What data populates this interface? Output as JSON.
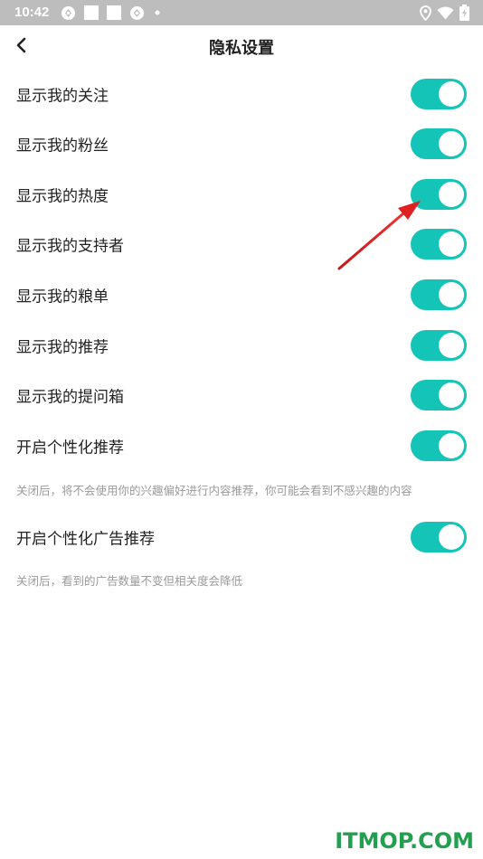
{
  "status_bar": {
    "time": "10:42",
    "left_icons": [
      "sync-icon",
      "square-notification-icon",
      "square-notification-icon",
      "sync-icon",
      "dot-icon"
    ],
    "right_icons": [
      "location-icon",
      "wifi-icon",
      "battery-charging-icon"
    ]
  },
  "header": {
    "title": "隐私设置",
    "back_icon": "chevron-left-icon"
  },
  "settings": [
    {
      "label": "显示我的关注",
      "enabled": true
    },
    {
      "label": "显示我的粉丝",
      "enabled": true
    },
    {
      "label": "显示我的热度",
      "enabled": true
    },
    {
      "label": "显示我的支持者",
      "enabled": true
    },
    {
      "label": "显示我的粮单",
      "enabled": true
    },
    {
      "label": "显示我的推荐",
      "enabled": true
    },
    {
      "label": "显示我的提问箱",
      "enabled": true
    },
    {
      "label": "开启个性化推荐",
      "enabled": true,
      "hint": "关闭后，将不会使用你的兴趣偏好进行内容推荐，你可能会看到不感兴趣的内容"
    },
    {
      "label": "开启个性化广告推荐",
      "enabled": true,
      "hint": "关闭后，看到的广告数量不变但相关度会降低"
    }
  ],
  "colors": {
    "toggle_on": "#14c4b6",
    "annotation_arrow": "#e02020",
    "watermark": "#22a050",
    "status_bar": "#bdbdbd"
  },
  "watermark": "ITMOP.COM"
}
